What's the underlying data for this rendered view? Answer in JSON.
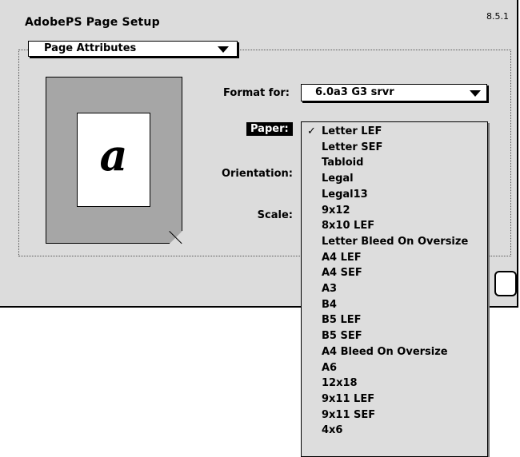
{
  "dialog": {
    "title": "AdobePS Page Setup",
    "version": "8.5.1"
  },
  "panel_popup": {
    "label": "Page Attributes"
  },
  "preview": {
    "glyph": "a"
  },
  "format_for": {
    "label": "Format for:",
    "value": "6.0a3 G3 srvr"
  },
  "paper": {
    "label": "Paper:"
  },
  "orientation": {
    "label": "Orientation:"
  },
  "scale": {
    "label": "Scale:"
  },
  "paper_menu": {
    "checkmark": "✓",
    "selected_index": 0,
    "items": [
      "Letter LEF",
      "Letter SEF",
      "Tabloid",
      "Legal",
      "Legal13",
      "9x12",
      "8x10 LEF",
      "Letter Bleed On Oversize",
      "A4 LEF",
      "A4 SEF",
      "A3",
      "B4",
      "B5 LEF",
      "B5 SEF",
      "A4 Bleed On Oversize",
      "A6",
      "12x18",
      "9x11 LEF",
      "9x11 SEF",
      "4x6"
    ]
  }
}
